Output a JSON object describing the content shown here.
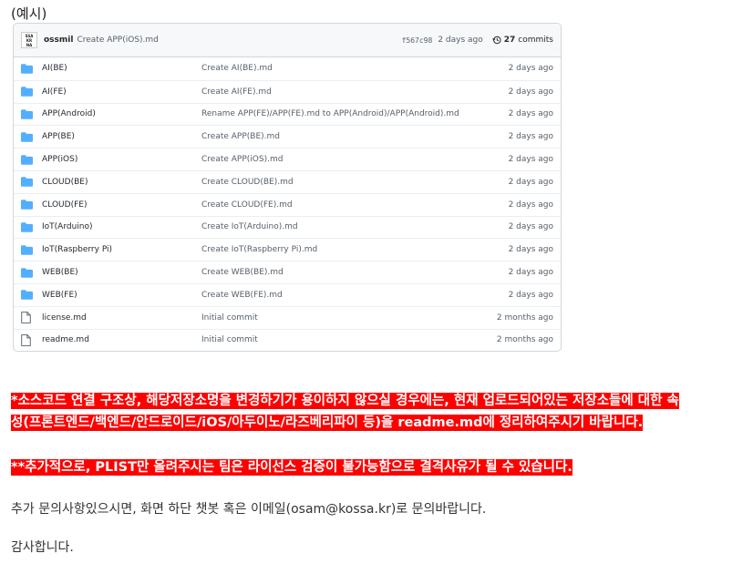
{
  "example_label": "(예시)",
  "repo": {
    "latest_commit": {
      "avatar_text": [
        "SSA",
        "KR",
        "NA"
      ],
      "author": "ossmil",
      "message": "Create APP(iOS).md",
      "sha": "f567c98",
      "time": "2 days ago",
      "commits_count": "27",
      "commits_label": "commits"
    },
    "files": [
      {
        "type": "folder",
        "name": "AI(BE)",
        "message": "Create AI(BE).md",
        "age": "2 days ago"
      },
      {
        "type": "folder",
        "name": "AI(FE)",
        "message": "Create AI(FE).md",
        "age": "2 days ago"
      },
      {
        "type": "folder",
        "name": "APP(Android)",
        "message": "Rename APP(FE)/APP(FE).md to APP(Android)/APP(Android).md",
        "age": "2 days ago"
      },
      {
        "type": "folder",
        "name": "APP(BE)",
        "message": "Create APP(BE).md",
        "age": "2 days ago"
      },
      {
        "type": "folder",
        "name": "APP(iOS)",
        "message": "Create APP(iOS).md",
        "age": "2 days ago"
      },
      {
        "type": "folder",
        "name": "CLOUD(BE)",
        "message": "Create CLOUD(BE).md",
        "age": "2 days ago"
      },
      {
        "type": "folder",
        "name": "CLOUD(FE)",
        "message": "Create CLOUD(FE).md",
        "age": "2 days ago"
      },
      {
        "type": "folder",
        "name": "IoT(Arduino)",
        "message": "Create IoT(Arduino).md",
        "age": "2 days ago"
      },
      {
        "type": "folder",
        "name": "IoT(Raspberry Pi)",
        "message": "Create IoT(Raspberry Pi).md",
        "age": "2 days ago"
      },
      {
        "type": "folder",
        "name": "WEB(BE)",
        "message": "Create WEB(BE).md",
        "age": "2 days ago"
      },
      {
        "type": "folder",
        "name": "WEB(FE)",
        "message": "Create WEB(FE).md",
        "age": "2 days ago"
      },
      {
        "type": "file",
        "name": "license.md",
        "message": "Initial commit",
        "age": "2 months ago"
      },
      {
        "type": "file",
        "name": "readme.md",
        "message": "Initial commit",
        "age": "2 months ago"
      }
    ]
  },
  "notice1_line1": "*소스코드 연결 구조상, 해당저장소명을 변경하기가 용이하지 않으실 경우에는, 현재 업로드되어있는 저장소들에 대한 속",
  "notice1_line2": "성(프론트엔드/백엔드/안드로이드/iOS/아두이노/라즈베리파이 등)을 readme.md에 정리하여주시기 바랍니다.",
  "notice2": "**추가적으로, PLIST만 올려주시는 팀은 라이선스 검증이 불가능함으로 결격사유가 될 수 있습니다.",
  "contact_text": "추가 문의사항있으시면, 화면 하단 챗봇 혹은 이메일(osam@kossa.kr)로 문의바랍니다.",
  "thanks_text": "감사합니다.",
  "colors": {
    "folder_icon": "#54aeff",
    "file_icon": "#57606a",
    "highlight": "#ff0000"
  }
}
